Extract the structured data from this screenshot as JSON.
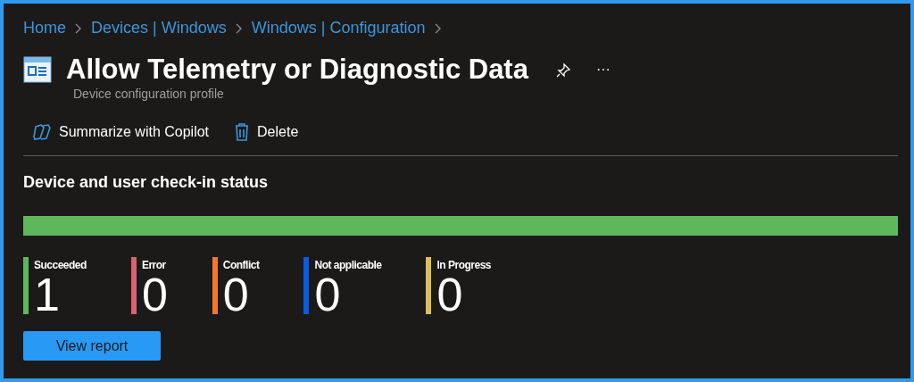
{
  "breadcrumb": [
    {
      "label": "Home"
    },
    {
      "label": "Devices | Windows"
    },
    {
      "label": "Windows | Configuration"
    }
  ],
  "header": {
    "title": "Allow Telemetry or Diagnostic Data",
    "subtitle": "Device configuration profile",
    "more": "···"
  },
  "toolbar": [
    {
      "kind": "copilot",
      "label": "Summarize with Copilot"
    },
    {
      "kind": "delete",
      "label": "Delete"
    }
  ],
  "status": {
    "title": "Device and user check-in status",
    "level": 1,
    "stats": [
      {
        "label": "Succeeded",
        "value": "1",
        "color": "#5db85c"
      },
      {
        "label": "Error",
        "value": "0",
        "color": "#d9636e"
      },
      {
        "label": "Conflict",
        "value": "0",
        "color": "#f7782a"
      },
      {
        "label": "Not applicable",
        "value": "0",
        "color": "#0a5ce0"
      },
      {
        "label": "In Progress",
        "value": "0",
        "color": "#dcbd5a"
      }
    ],
    "button": "View report"
  }
}
